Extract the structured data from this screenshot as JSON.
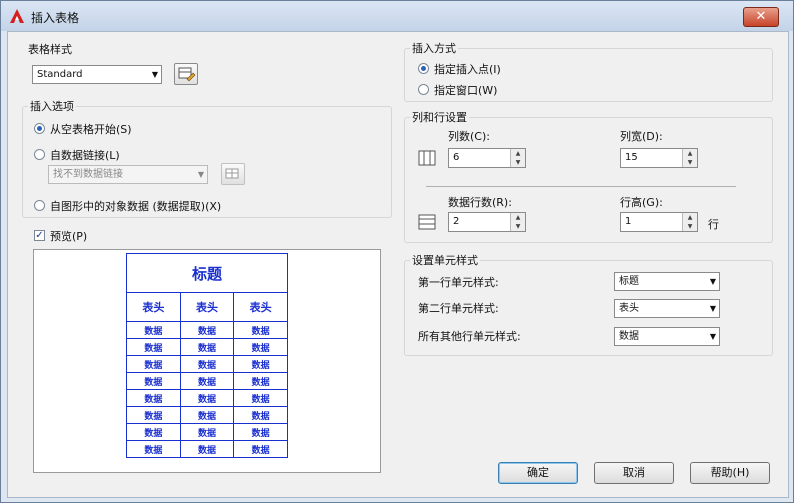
{
  "window": {
    "title": "插入表格",
    "close_label": "✕"
  },
  "table_style": {
    "label": "表格样式",
    "selected": "Standard"
  },
  "insert_options": {
    "label": "插入选项",
    "from_empty": "从空表格开始(S)",
    "from_link": "自数据链接(L)",
    "link_selected": "找不到数据链接",
    "from_objects": "自图形中的对象数据 (数据提取)(X)"
  },
  "preview": {
    "label": "预览(P)",
    "checked": true,
    "title": "标题",
    "headers": [
      "表头",
      "表头",
      "表头"
    ],
    "data_cell": "数据",
    "data_rows": 8
  },
  "insert_method": {
    "label": "插入方式",
    "specify_point": "指定插入点(I)",
    "specify_window": "指定窗口(W)"
  },
  "col_row_settings": {
    "label": "列和行设置",
    "columns_label": "列数(C):",
    "columns_value": "6",
    "col_width_label": "列宽(D):",
    "col_width_value": "15",
    "data_rows_label": "数据行数(R):",
    "data_rows_value": "2",
    "row_height_label": "行高(G):",
    "row_height_value": "1",
    "row_unit": "行"
  },
  "cell_styles": {
    "label": "设置单元样式",
    "first_row_label": "第一行单元样式:",
    "first_row_value": "标题",
    "second_row_label": "第二行单元样式:",
    "second_row_value": "表头",
    "other_rows_label": "所有其他行单元样式:",
    "other_rows_value": "数据"
  },
  "buttons": {
    "ok": "确定",
    "cancel": "取消",
    "help": "帮助(H)"
  },
  "colors": {
    "preview_table": "#1a2fd0",
    "close_button": "#c7432a",
    "title_logo": "#d42020"
  }
}
